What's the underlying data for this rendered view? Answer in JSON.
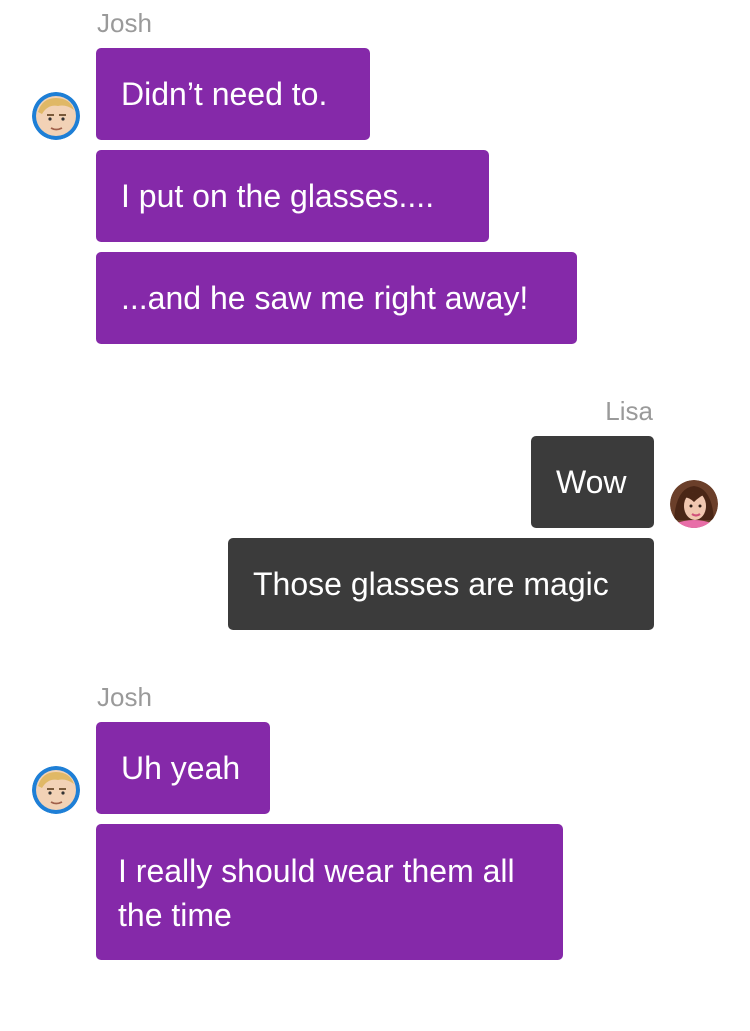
{
  "conversation": {
    "groups": [
      {
        "sender": "Josh",
        "messages": [
          "Didn’t need to.",
          "I put on the glasses....",
          "...and he saw me right away!"
        ]
      },
      {
        "sender": "Lisa",
        "messages": [
          "Wow",
          "Those glasses are magic"
        ]
      },
      {
        "sender": "Josh",
        "messages": [
          "Uh yeah",
          "I really should wear them all the time"
        ]
      }
    ]
  },
  "colors": {
    "josh_bubble": "#8529a9",
    "lisa_bubble": "#3b3b3b",
    "sender_name": "#9a9a9a",
    "josh_avatar_ring": "#1e7fd6"
  },
  "icons": {
    "josh_avatar": "josh-avatar-icon",
    "lisa_avatar": "lisa-avatar-icon"
  }
}
